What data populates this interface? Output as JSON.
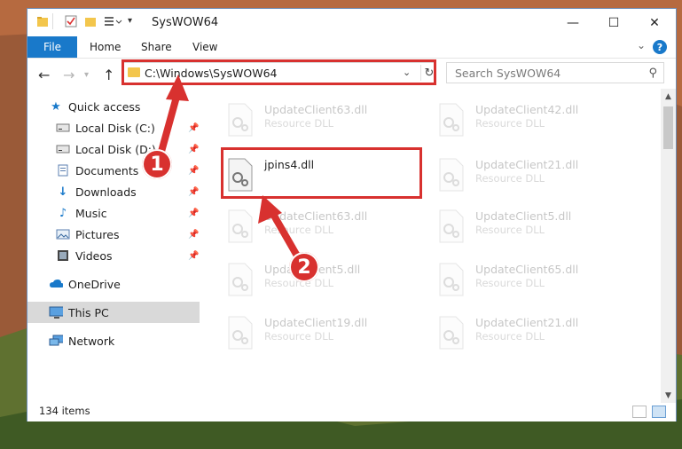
{
  "window": {
    "title": "SysWOW64",
    "controls": {
      "minimize": "—",
      "maximize": "☐",
      "close": "✕"
    }
  },
  "ribbon": {
    "tabs": [
      "File",
      "Home",
      "Share",
      "View"
    ],
    "help": "?"
  },
  "navigation": {
    "address": "C:\\Windows\\SysWOW64",
    "search_placeholder": "Search SysWOW64"
  },
  "sidebar": {
    "items": [
      {
        "label": "Quick access",
        "icon": "star-icon",
        "pinned": false
      },
      {
        "label": "Local Disk (C:)",
        "icon": "drive-icon",
        "pinned": true
      },
      {
        "label": "Local Disk (D:)",
        "icon": "drive-icon",
        "pinned": true
      },
      {
        "label": "Documents",
        "icon": "document-icon",
        "pinned": true
      },
      {
        "label": "Downloads",
        "icon": "download-icon",
        "pinned": true
      },
      {
        "label": "Music",
        "icon": "music-icon",
        "pinned": true
      },
      {
        "label": "Pictures",
        "icon": "picture-icon",
        "pinned": true
      },
      {
        "label": "Videos",
        "icon": "video-icon",
        "pinned": true
      },
      {
        "label": "OneDrive",
        "icon": "cloud-icon",
        "pinned": false
      },
      {
        "label": "This PC",
        "icon": "pc-icon",
        "pinned": false,
        "selected": true
      },
      {
        "label": "Network",
        "icon": "network-icon",
        "pinned": false
      }
    ]
  },
  "files": [
    {
      "name": "UpdateClient63.dll",
      "type": "Resource DLL"
    },
    {
      "name": "UpdateClient42.dll",
      "type": "Resource DLL"
    },
    {
      "name": "jpins4.dll",
      "type": "",
      "highlighted": true
    },
    {
      "name": "UpdateClient21.dll",
      "type": "Resource DLL"
    },
    {
      "name": "UpdateClient63.dll",
      "type": "Resource DLL"
    },
    {
      "name": "UpdateClient5.dll",
      "type": "Resource DLL"
    },
    {
      "name": "UpdateClient5.dll",
      "type": "Resource DLL"
    },
    {
      "name": "UpdateClient65.dll",
      "type": "Resource DLL"
    },
    {
      "name": "UpdateClient19.dll",
      "type": "Resource DLL"
    },
    {
      "name": "UpdateClient21.dll",
      "type": "Resource DLL"
    }
  ],
  "status": {
    "item_count": "134 items"
  },
  "annotations": {
    "step1": "1",
    "step2": "2",
    "color": "#d8312f"
  }
}
